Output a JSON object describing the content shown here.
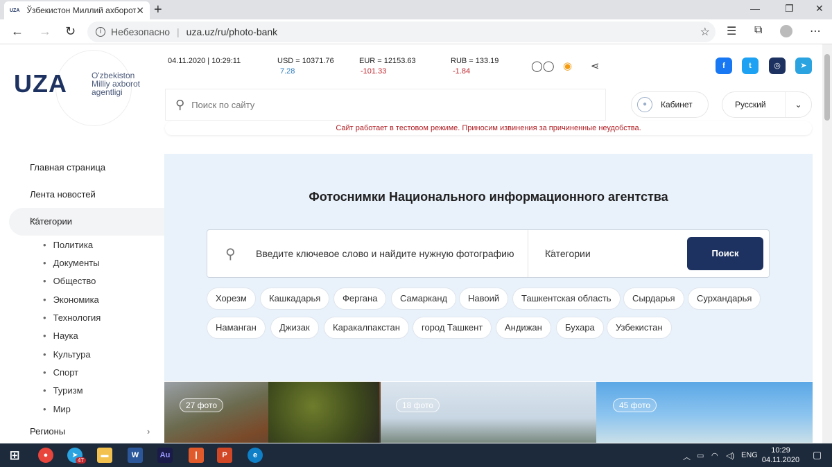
{
  "browser": {
    "tab_title": "Ўзбекистон Миллий ахборот агентлиги",
    "favicon_text": "UZA",
    "new_tab": "+",
    "insecure_label": "Небезопасно",
    "url": "uza.uz/ru/photo-bank",
    "minimize": "—",
    "restore": "❐",
    "close": "✕"
  },
  "header": {
    "logo_text": "UZA",
    "logo_subtitle": "O'zbekiston Milliy axborot agentligi",
    "datetime": "04.11.2020 | 10:29:11",
    "rates": [
      {
        "label": "USD = 10371.76",
        "change": "7.28"
      },
      {
        "label": "EUR = 12153.63",
        "change": "-101.33"
      },
      {
        "label": "RUB = 133.19",
        "change": "-1.84"
      }
    ],
    "search_placeholder": "Поиск по сайту",
    "cabinet_label": "Кабинет",
    "language": "Русский",
    "notice": "Сайт работает в тестовом режиме. Приносим извинения за причиненные неудобства.",
    "social_colors": {
      "facebook": "#1877f2",
      "twitter": "#1da1f2",
      "instagram": "#1d3260",
      "telegram": "#2aa3e0"
    }
  },
  "sidebar": {
    "home": "Главная страница",
    "feed": "Лента новостей",
    "categories": "Категории",
    "category_items": [
      "Политика",
      "Документы",
      "Общество",
      "Экономика",
      "Технология",
      "Наука",
      "Культура",
      "Спорт",
      "Туризм",
      "Мир"
    ],
    "regions": "Регионы"
  },
  "photo_bank": {
    "title": "Фотоснимки Национального информационного агентства",
    "search_value": "Введите ключевое слово и найдите нужную фотографию",
    "category_select": "Категории",
    "search_button": "Поиск",
    "regions_row1": [
      "Хорезм",
      "Кашкадарья",
      "Фергана",
      "Самарканд",
      "Навоий",
      "Ташкентская область",
      "Сырдарья",
      "Сурхандарья"
    ],
    "regions_row2": [
      "Наманган",
      "Джизак",
      "Каракалпакстан",
      "город Ташкент",
      "Андижан",
      "Бухара",
      "Узбекистан"
    ],
    "albums": [
      {
        "count": "27 фото"
      },
      {
        "count": "18 фото"
      },
      {
        "count": "45 фото"
      }
    ]
  },
  "taskbar": {
    "lang": "ENG",
    "time": "10:29",
    "date": "04.11.2020",
    "telegram_badge": "47"
  },
  "colors": {
    "brand": "#1d3260",
    "hero_bg": "#e9f1fb",
    "positive": "#2b7bbf",
    "negative": "#c0262d"
  }
}
